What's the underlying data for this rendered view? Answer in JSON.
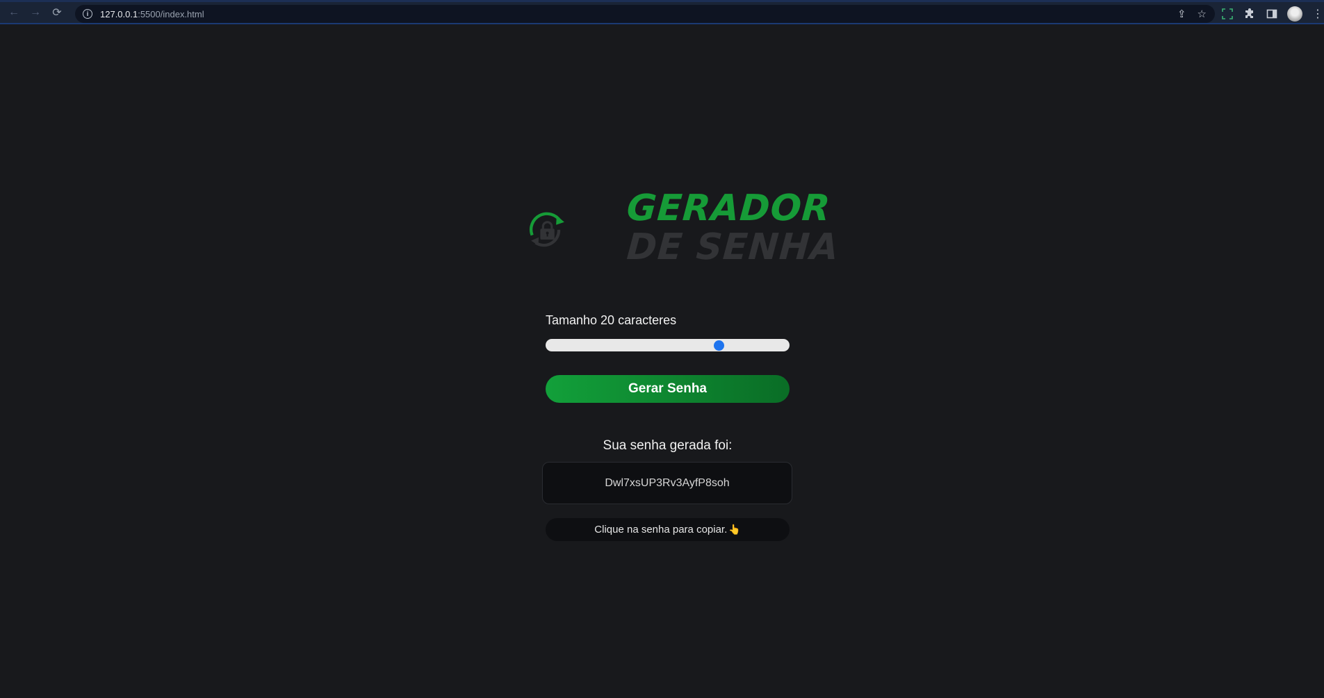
{
  "browser": {
    "url_host": "127.0.0.1",
    "url_rest": ":5500/index.html",
    "back_icon": "←",
    "forward_icon": "→",
    "reload_icon": "⟳",
    "info_icon": "i",
    "share_icon": "⇪",
    "star_icon": "☆",
    "menu_icon": "⋮"
  },
  "logo": {
    "line1": "GERADOR",
    "line2": "DE SENHA",
    "colors": {
      "green": "#169b37",
      "gray": "#323336"
    }
  },
  "slider": {
    "label": "Tamanho 20 caracteres",
    "value_fraction": 0.72
  },
  "generate_button": {
    "label": "Gerar Senha"
  },
  "result": {
    "title": "Sua senha gerada foi:",
    "password": "Dwl7xsUP3Rv3AyfP8soh",
    "hint": "Clique na senha para copiar.",
    "hint_emoji": "👆"
  },
  "colors": {
    "background": "#18191c",
    "accent": "#1e74ee",
    "button_start": "#12a03a",
    "button_end": "#0a6d26"
  }
}
